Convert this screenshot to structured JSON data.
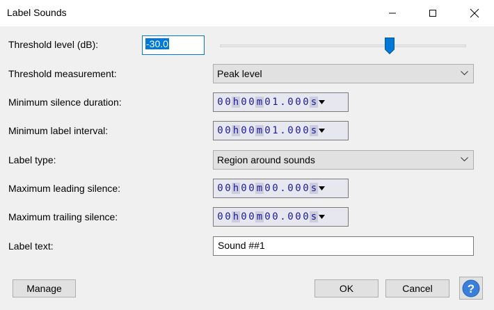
{
  "window": {
    "title": "Label Sounds"
  },
  "threshold_level": {
    "label": "Threshold level (dB):",
    "value": "-30.0",
    "slider_fraction": 0.69
  },
  "threshold_measurement": {
    "label": "Threshold measurement:",
    "value": "Peak level"
  },
  "min_silence_duration": {
    "label": "Minimum silence duration:",
    "digits": [
      "0",
      "0",
      "h",
      "0",
      "0",
      "m",
      "0",
      "1",
      ".",
      "0",
      "0",
      "0",
      "s"
    ]
  },
  "min_label_interval": {
    "label": "Minimum label interval:",
    "digits": [
      "0",
      "0",
      "h",
      "0",
      "0",
      "m",
      "0",
      "1",
      ".",
      "0",
      "0",
      "0",
      "s"
    ]
  },
  "label_type": {
    "label": "Label type:",
    "value": "Region around sounds"
  },
  "max_leading_silence": {
    "label": "Maximum leading silence:",
    "digits": [
      "0",
      "0",
      "h",
      "0",
      "0",
      "m",
      "0",
      "0",
      ".",
      "0",
      "0",
      "0",
      "s"
    ]
  },
  "max_trailing_silence": {
    "label": "Maximum trailing silence:",
    "digits": [
      "0",
      "0",
      "h",
      "0",
      "0",
      "m",
      "0",
      "0",
      ".",
      "0",
      "0",
      "0",
      "s"
    ]
  },
  "label_text": {
    "label": "Label text:",
    "value": "Sound ##1"
  },
  "buttons": {
    "manage": "Manage",
    "ok": "OK",
    "cancel": "Cancel"
  },
  "icons": {
    "minimize": "minimize-icon",
    "maximize": "maximize-icon",
    "close": "close-icon",
    "help": "help-icon",
    "dropdown": "chevron-down-icon"
  },
  "colors": {
    "accent": "#0078d7",
    "digits": "#1a1aa0"
  }
}
